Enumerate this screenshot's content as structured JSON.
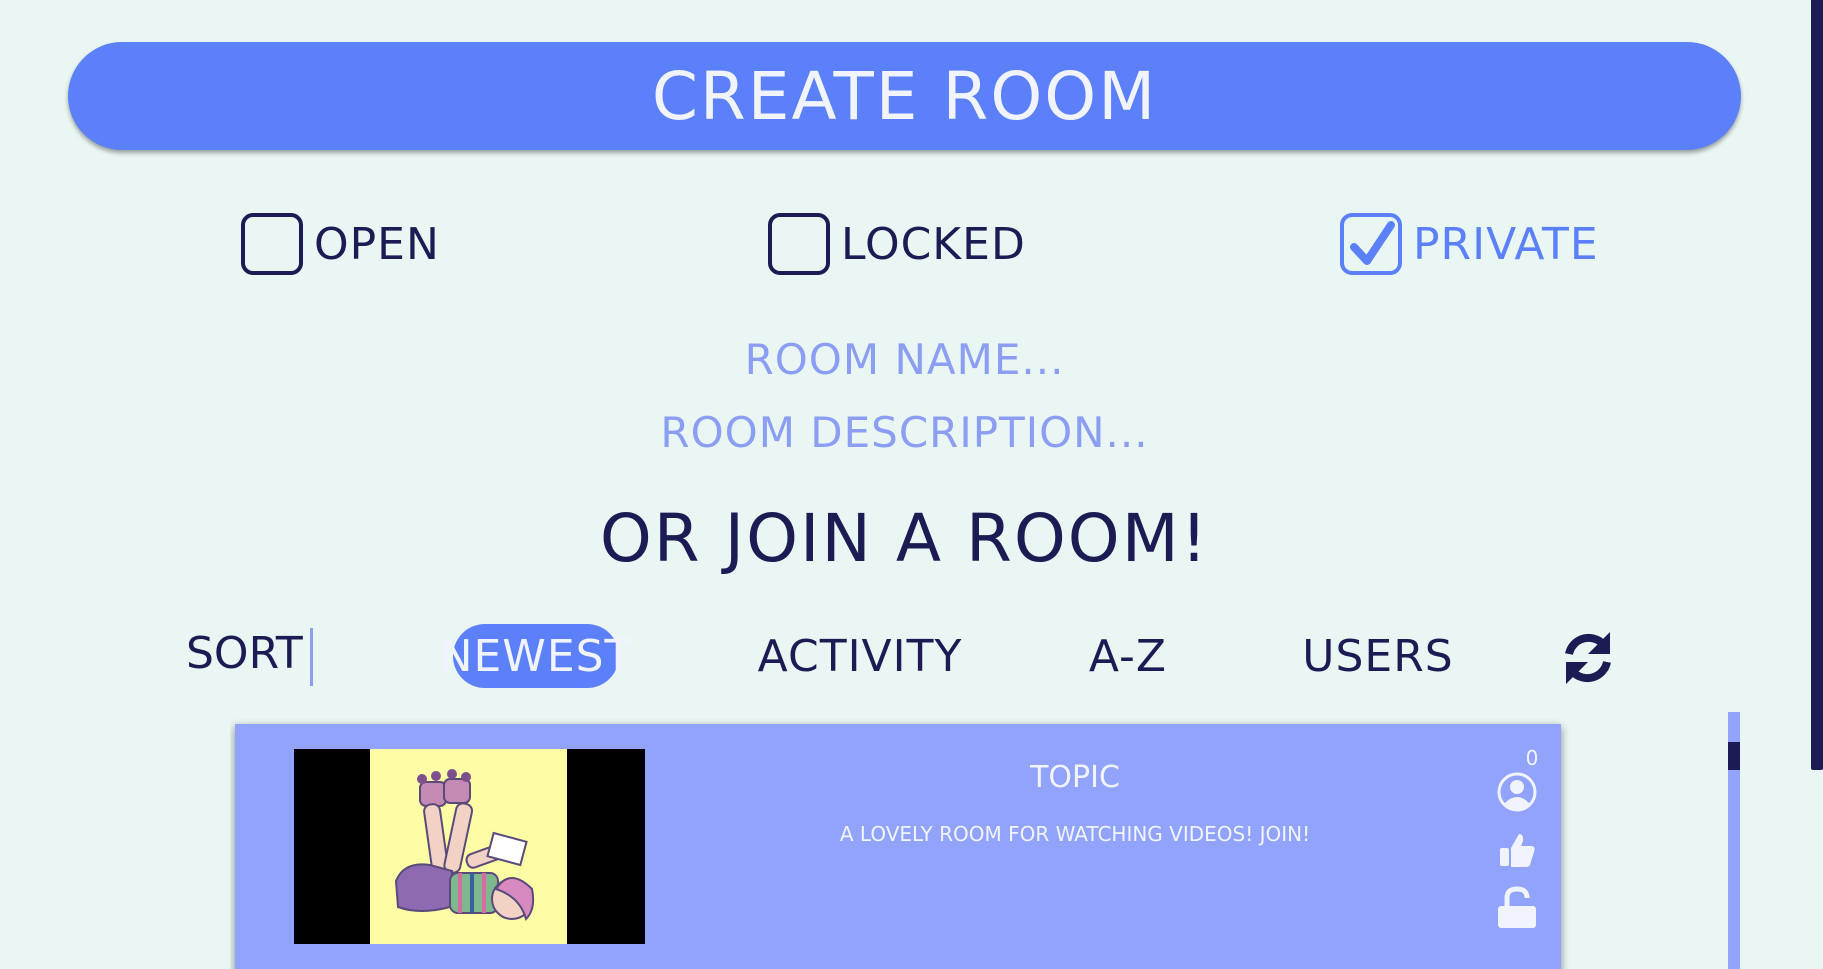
{
  "create_room": {
    "button_label": "CREATE ROOM"
  },
  "privacy_options": [
    {
      "label": "OPEN",
      "checked": false
    },
    {
      "label": "LOCKED",
      "checked": false
    },
    {
      "label": "PRIVATE",
      "checked": true
    }
  ],
  "form": {
    "room_name_placeholder": "ROOM NAME...",
    "room_description_placeholder": "ROOM DESCRIPTION..."
  },
  "join": {
    "heading": "OR JOIN A ROOM!"
  },
  "sort": {
    "label": "SORT",
    "options": [
      {
        "label": "NEWEST",
        "active": true
      },
      {
        "label": "ACTIVITY",
        "active": false
      },
      {
        "label": "A-Z",
        "active": false
      },
      {
        "label": "USERS",
        "active": false
      }
    ],
    "refresh_icon": "refresh-icon"
  },
  "rooms": [
    {
      "topic": "TOPIC",
      "description": "A LOVELY ROOM FOR WATCHING VIDEOS! JOIN!",
      "user_count": "0",
      "status_icon": "unlocked-icon",
      "like_icon": "thumbs-up-icon",
      "user_icon": "user-icon"
    }
  ],
  "colors": {
    "background": "#eaf6f3",
    "accent": "#5b80fa",
    "dark": "#1d1b53",
    "card": "#91a3fa",
    "placeholder": "#8b9ef3"
  }
}
